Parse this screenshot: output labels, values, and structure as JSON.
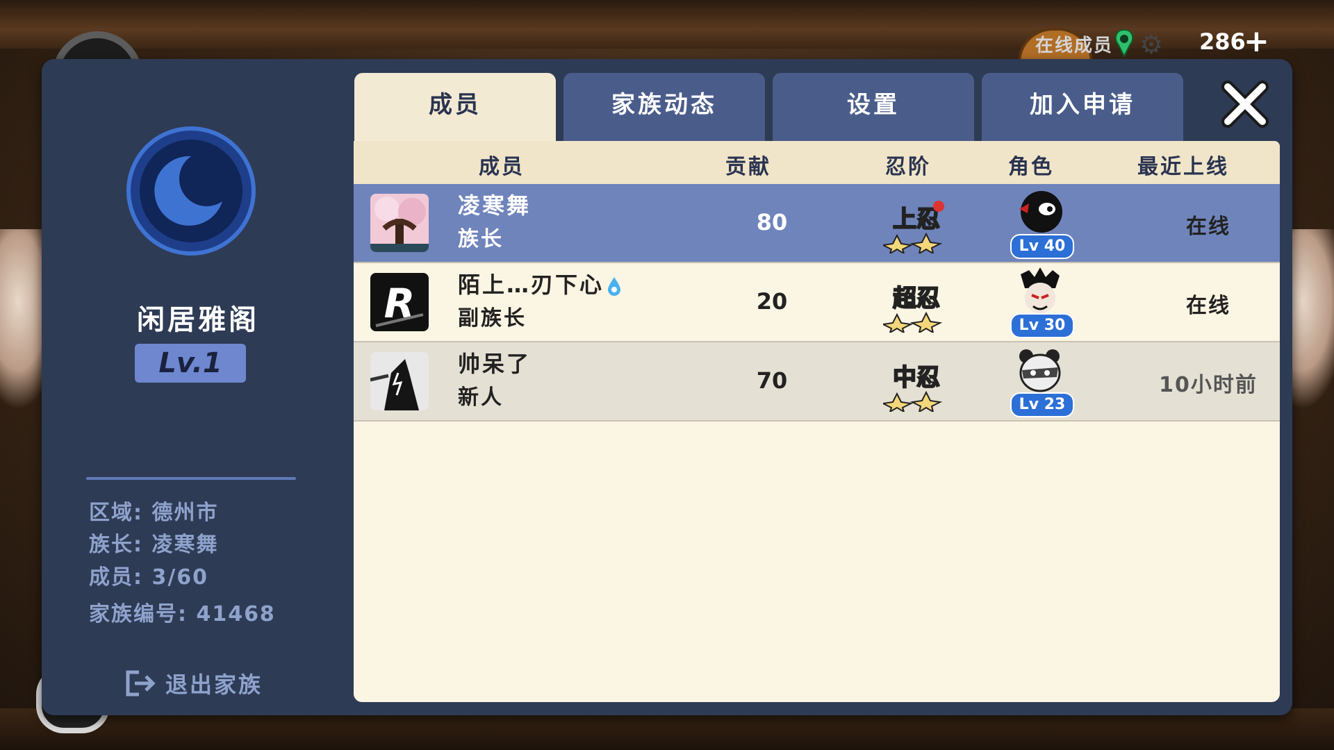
{
  "topbar": {
    "online_label": "在线成员",
    "gem_count": "286",
    "plus_label": "+"
  },
  "clan": {
    "name": "闲居雅阁",
    "level": "Lv.1",
    "region": "区域: 德州市",
    "leader": "族长: 凌寒舞",
    "members": "成员: 3/60",
    "clan_id": "家族编号: 41468",
    "exit_label": "退出家族"
  },
  "tabs": [
    {
      "label": "成员",
      "active": true
    },
    {
      "label": "家族动态",
      "active": false
    },
    {
      "label": "设置",
      "active": false
    },
    {
      "label": "加入申请",
      "active": false
    }
  ],
  "table": {
    "headers": [
      "成员",
      "贡献",
      "忍阶",
      "角色",
      "最近上线"
    ],
    "rows": [
      {
        "name": "凌寒舞",
        "role": "族长",
        "contribution": "80",
        "rank": "上忍",
        "level": "Lv 40",
        "last_online": "在线",
        "avatar": "sakura-tree",
        "character": "black-ninja"
      },
      {
        "name": "陌上…刃下心",
        "role": "副族长",
        "contribution": "20",
        "rank": "超忍",
        "level": "Lv 30",
        "last_online": "在线",
        "avatar": "letter-r",
        "character": "tengu-mask"
      },
      {
        "name": "帅呆了",
        "role": "新人",
        "contribution": "70",
        "rank": "中忍",
        "level": "Lv 23",
        "last_online": "10小时前",
        "avatar": "shadow-ninja",
        "character": "panda-ninja"
      }
    ]
  },
  "colors": {
    "panel": "#2e3b55",
    "tab_inactive": "#4a5d8a",
    "tab_active": "#f3ead4",
    "row_selected": "#6f84bb",
    "badge_blue": "#2c6fd6"
  }
}
